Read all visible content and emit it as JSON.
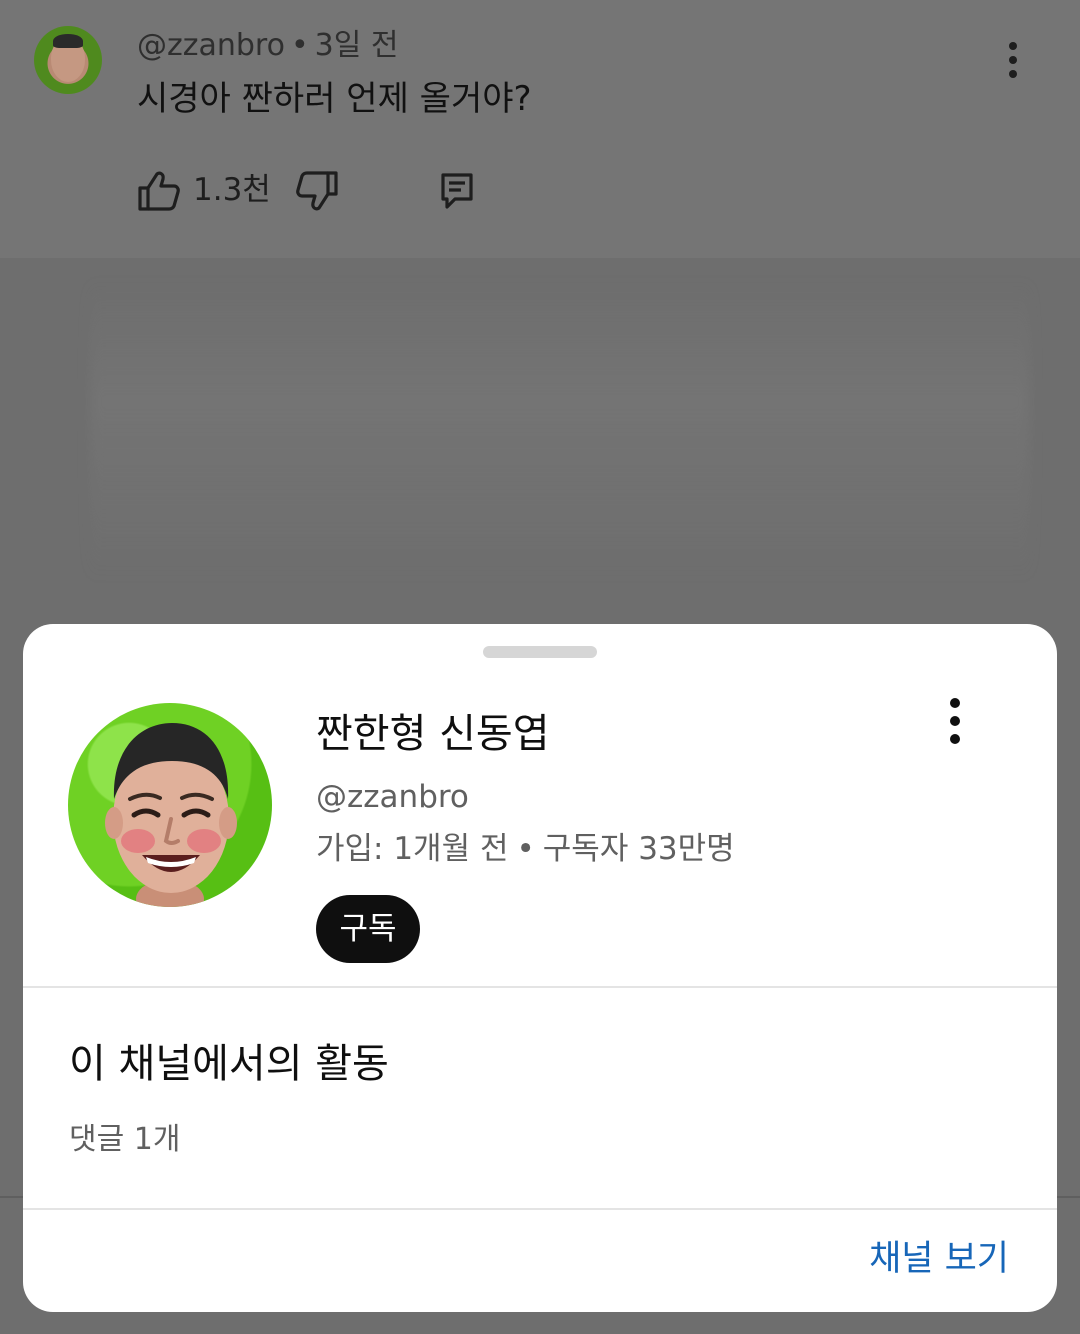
{
  "background_comment": {
    "author_handle": "@zzanbro",
    "separator": "•",
    "time_ago": "3일 전",
    "text": "시경아 짠하러 언제 올거야?",
    "like_count": "1.3천",
    "icons": {
      "more": "more-vert-icon",
      "like": "thumbs-up-icon",
      "dislike": "thumbs-down-icon",
      "reply": "reply-icon"
    }
  },
  "channel_sheet": {
    "name": "짠한형 신동엽",
    "handle": "@zzanbro",
    "joined": "가입: 1개월 전",
    "separator": "•",
    "subscribers": "구독자 33만명",
    "subscribe_label": "구독",
    "activity_title": "이 채널에서의 활동",
    "activity_count": "댓글 1개",
    "view_channel_label": "채널 보기",
    "icons": {
      "more": "more-vert-icon"
    }
  },
  "colors": {
    "link": "#1766b8",
    "subscribe_button": "#0f0f0f",
    "avatar_background": "#6fd124"
  }
}
